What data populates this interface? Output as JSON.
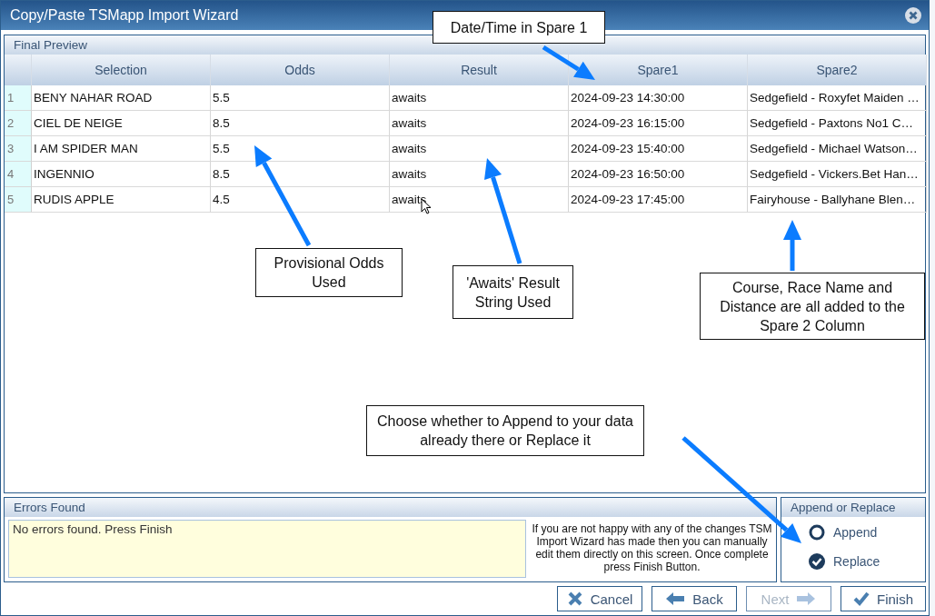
{
  "window": {
    "title": "Copy/Paste TSMapp Import Wizard"
  },
  "preview": {
    "title": "Final Preview",
    "columns": [
      "Selection",
      "Odds",
      "Result",
      "Spare1",
      "Spare2"
    ],
    "rows": [
      {
        "number": "1",
        "cells": [
          "BENY NAHAR ROAD",
          "5.5",
          "awaits",
          "2024-09-23 14:30:00",
          "Sedgefield - Roxyfet Maiden …"
        ]
      },
      {
        "number": "2",
        "cells": [
          "CIEL DE NEIGE",
          "8.5",
          "awaits",
          "2024-09-23 16:15:00",
          "Sedgefield - Paxtons No1 C…"
        ]
      },
      {
        "number": "3",
        "cells": [
          "I AM SPIDER MAN",
          "5.5",
          "awaits",
          "2024-09-23 15:40:00",
          "Sedgefield - Michael Watson…"
        ]
      },
      {
        "number": "4",
        "cells": [
          "INGENNIO",
          "8.5",
          "awaits",
          "2024-09-23 16:50:00",
          "Sedgefield - Vickers.Bet Han…"
        ]
      },
      {
        "number": "5",
        "cells": [
          "RUDIS APPLE",
          "4.5",
          "awaits",
          "2024-09-23 17:45:00",
          "Fairyhouse - Ballyhane Blen…"
        ]
      }
    ]
  },
  "errors": {
    "title": "Errors Found",
    "text": "No errors found. Press Finish",
    "help": "If you are not happy with any of the changes TSM Import Wizard has made then you can manually edit them directly on this screen. Once complete press Finish Button."
  },
  "mode": {
    "title": "Append or Replace",
    "options": [
      {
        "label": "Append",
        "selected": false
      },
      {
        "label": "Replace",
        "selected": true
      }
    ]
  },
  "buttons": [
    {
      "kind": "cancel",
      "label": "Cancel",
      "disabled": false
    },
    {
      "kind": "back",
      "label": "Back",
      "disabled": false
    },
    {
      "kind": "next",
      "label": "Next",
      "disabled": true
    },
    {
      "kind": "finish",
      "label": "Finish",
      "disabled": false
    }
  ],
  "annotations": [
    "Date/Time in Spare 1",
    "Provisional Odds Used",
    "'Awaits' Result String Used",
    "Course, Race Name and Distance are all added to the Spare 2 Column",
    "Choose whether to Append to your data already there or Replace it"
  ]
}
